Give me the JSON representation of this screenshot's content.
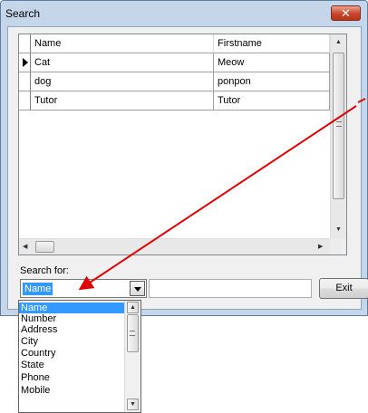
{
  "window": {
    "title": "Search",
    "close_label": "✕"
  },
  "grid": {
    "columns": [
      "Name",
      "Firstname"
    ],
    "rows": [
      {
        "name": "Cat",
        "firstname": "Meow",
        "current": true
      },
      {
        "name": "dog",
        "firstname": "ponpon",
        "current": false
      },
      {
        "name": "Tutor",
        "firstname": "Tutor",
        "current": false
      }
    ]
  },
  "search": {
    "label": "Search for:",
    "selected_field": "Name",
    "input_value": "",
    "exit_label": "Exit",
    "options": [
      "Name",
      "Number",
      "Address",
      "City",
      "Country",
      "State",
      "Phone",
      "Mobile"
    ]
  },
  "colors": {
    "selection": "#3399ff",
    "annotation_arrow": "#e00000"
  },
  "icons": {
    "close": "close-icon",
    "row_indicator": "row-pointer-icon",
    "dropdown": "chevron-down-icon"
  }
}
